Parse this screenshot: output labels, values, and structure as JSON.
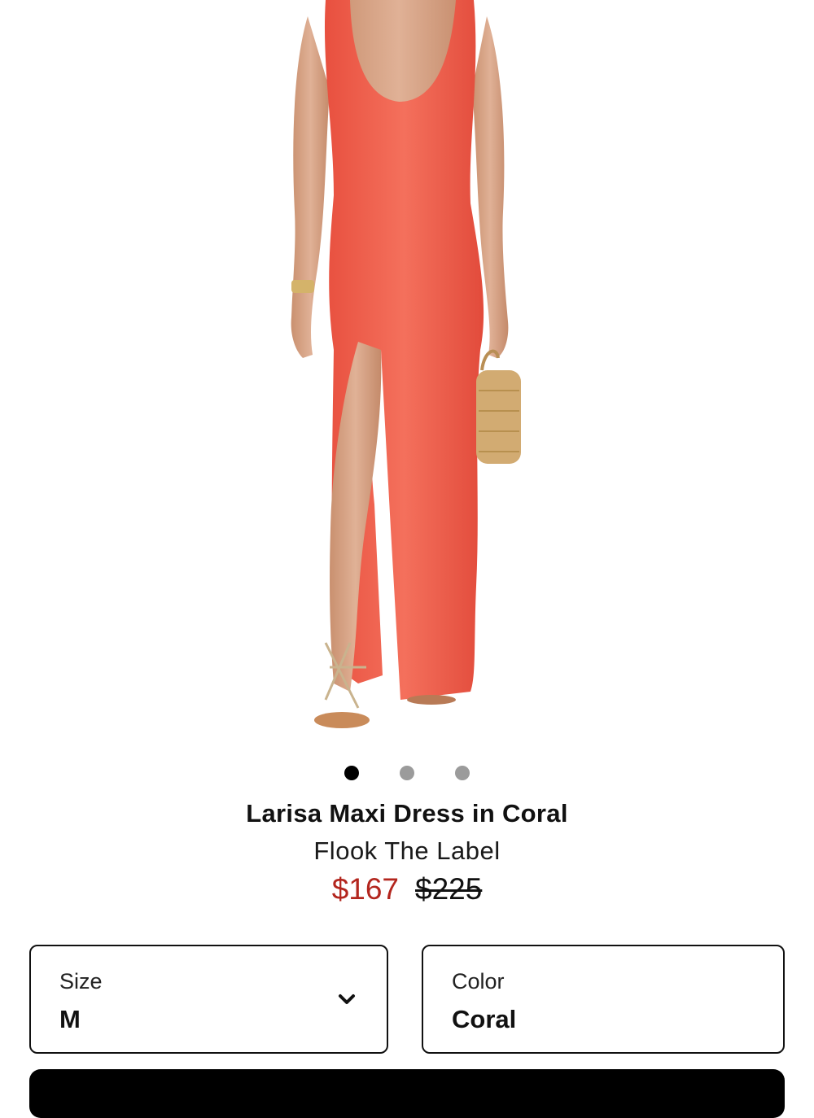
{
  "product": {
    "title": "Larisa Maxi Dress in Coral",
    "brand": "Flook The Label",
    "sale_price": "$167",
    "original_price": "$225",
    "image_alt_icon": "product-photo"
  },
  "carousel": {
    "count": 3,
    "active_index": 0
  },
  "options": {
    "size": {
      "label": "Size",
      "value": "M",
      "icon": "chevron-down-icon"
    },
    "color": {
      "label": "Color",
      "value": "Coral"
    }
  },
  "colors": {
    "sale_price": "#b3261e",
    "dress": "#f0604f",
    "dot_active": "#000000",
    "dot_inactive": "#9b9b9b"
  }
}
